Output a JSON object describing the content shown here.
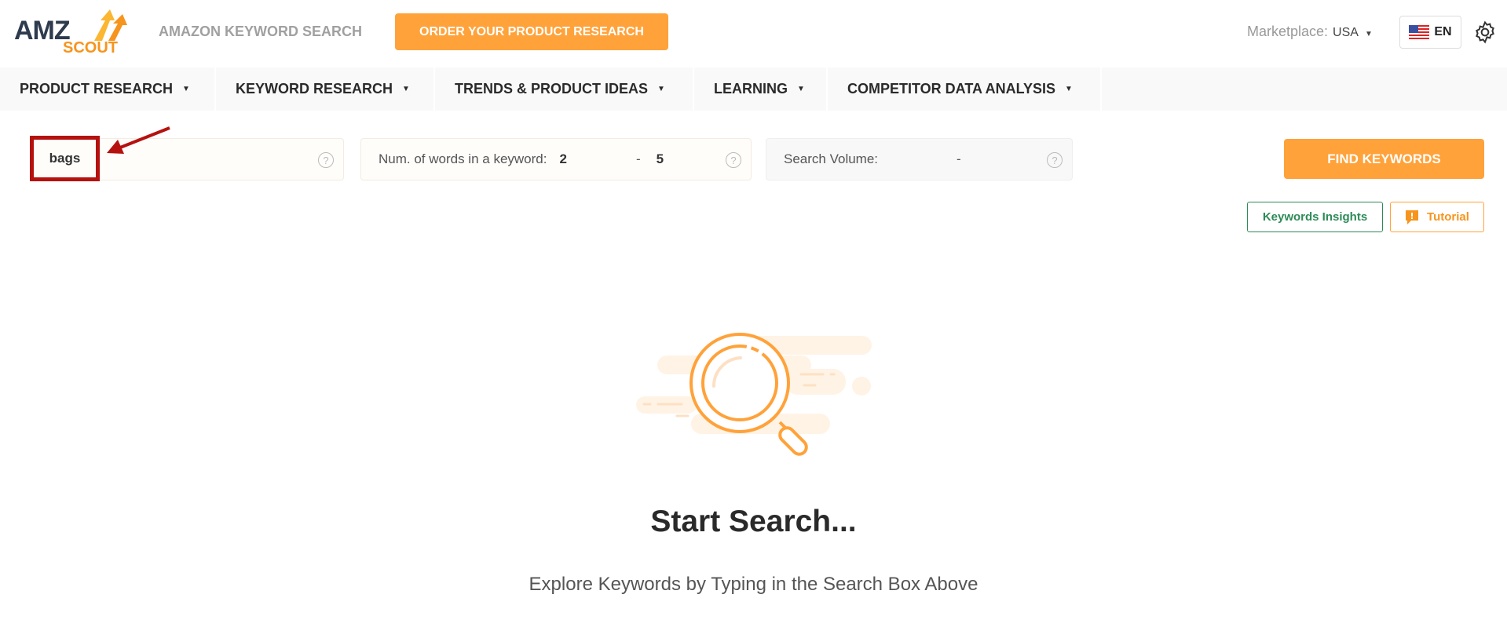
{
  "header": {
    "logo_text": "AMZ SCOUT",
    "title": "AMAZON KEYWORD SEARCH",
    "order_button": "ORDER YOUR PRODUCT RESEARCH",
    "marketplace_label": "Marketplace:",
    "marketplace_value": "USA",
    "language": "EN"
  },
  "nav": {
    "items": [
      {
        "label": "PRODUCT RESEARCH"
      },
      {
        "label": "KEYWORD RESEARCH"
      },
      {
        "label": "TRENDS & PRODUCT IDEAS"
      },
      {
        "label": "LEARNING"
      },
      {
        "label": "COMPETITOR DATA ANALYSIS"
      }
    ]
  },
  "search": {
    "keyword_value": "bags",
    "words_label": "Num. of words in a keyword:",
    "words_min": "2",
    "words_separator": "-",
    "words_max": "5",
    "volume_label": "Search Volume:",
    "volume_value": "-",
    "help": "?",
    "find_button": "FIND KEYWORDS",
    "insights_button": "Keywords Insights",
    "tutorial_button": "Tutorial"
  },
  "empty_state": {
    "title": "Start Search...",
    "subtitle": "Explore Keywords by Typing in the Search Box Above"
  },
  "colors": {
    "accent": "#ffa23a",
    "green": "#2e8b57",
    "highlight": "#b5120f"
  }
}
